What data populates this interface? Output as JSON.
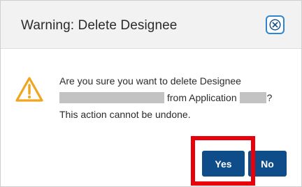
{
  "dialog": {
    "title": "Warning: Delete Designee",
    "close_icon": "close-icon",
    "warning_icon": "warning-triangle-icon",
    "message": {
      "line1": "Are you sure you want to delete Designee",
      "line2_after_name": "from Application",
      "line2_end": "?",
      "line3": "This action cannot be undone."
    },
    "buttons": {
      "yes_label": "Yes",
      "no_label": "No"
    }
  },
  "colors": {
    "accent": "#2e86d1",
    "button": "#0f4c8a",
    "warning": "#f0a51f",
    "highlight": "#e8000b",
    "redaction": "#c3c3c3"
  }
}
